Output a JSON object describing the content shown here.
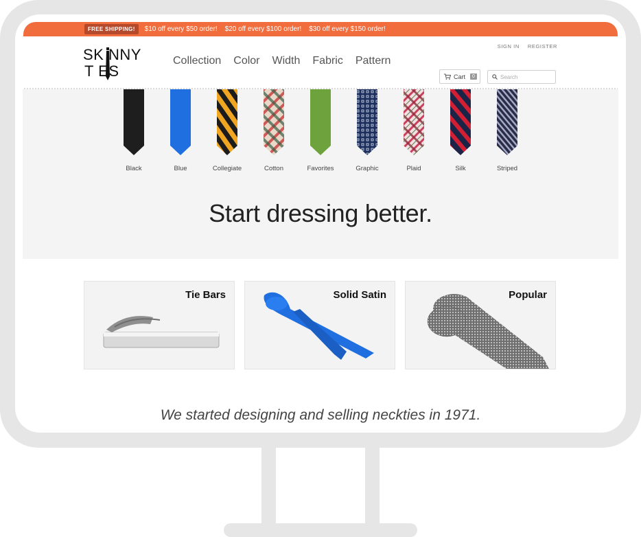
{
  "promo": {
    "badge": "FREE SHIPPING!",
    "offers": [
      "$10 off every $50 order!",
      "$20 off every $100 order!",
      "$30 off every $150 order!"
    ]
  },
  "brand": {
    "line1": "SK NNY",
    "line2": "T ES"
  },
  "nav": [
    "Collection",
    "Color",
    "Width",
    "Fabric",
    "Pattern"
  ],
  "account": {
    "sign_in": "SIGN IN",
    "register": "REGISTER"
  },
  "cart": {
    "label": "Cart",
    "count": "0"
  },
  "search": {
    "placeholder": "Search"
  },
  "ties": [
    {
      "label": "Black"
    },
    {
      "label": "Blue"
    },
    {
      "label": "Collegiate"
    },
    {
      "label": "Cotton"
    },
    {
      "label": "Favorites"
    },
    {
      "label": "Graphic"
    },
    {
      "label": "Plaid"
    },
    {
      "label": "Silk"
    },
    {
      "label": "Striped"
    }
  ],
  "tagline": "Start dressing better.",
  "cards": [
    {
      "title": "Tie Bars"
    },
    {
      "title": "Solid Satin"
    },
    {
      "title": "Popular"
    }
  ],
  "story": "We started designing and selling neckties in 1971.",
  "colors": {
    "promo": "#f26d3d",
    "badge": "#b5492c",
    "tie_section_bg": "#f4f4f4"
  },
  "icons": {
    "cart": "cart-icon",
    "search": "search-icon"
  }
}
